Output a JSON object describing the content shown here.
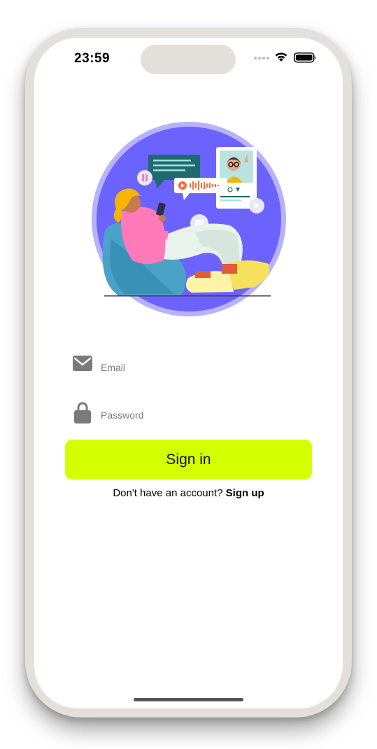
{
  "status_bar": {
    "time": "23:59"
  },
  "login_form": {
    "email_placeholder": "Email",
    "email_value": "",
    "password_placeholder": "Password",
    "password_value": "",
    "sign_in_label": "Sign in"
  },
  "signup_prompt": {
    "question": "Don't have an account?",
    "link_label": "Sign up"
  },
  "icons": {
    "email": "envelope-icon",
    "password": "lock-icon",
    "wifi": "wifi-icon",
    "battery": "battery-icon",
    "signal": "signal-dots-icon"
  },
  "colors": {
    "accent": "#d4ff00",
    "illustration_circle": "#6c63ff",
    "illustration_ring": "#b6b2ff",
    "icon_gray": "#7a7a7a",
    "frame": "#e3e0db"
  }
}
